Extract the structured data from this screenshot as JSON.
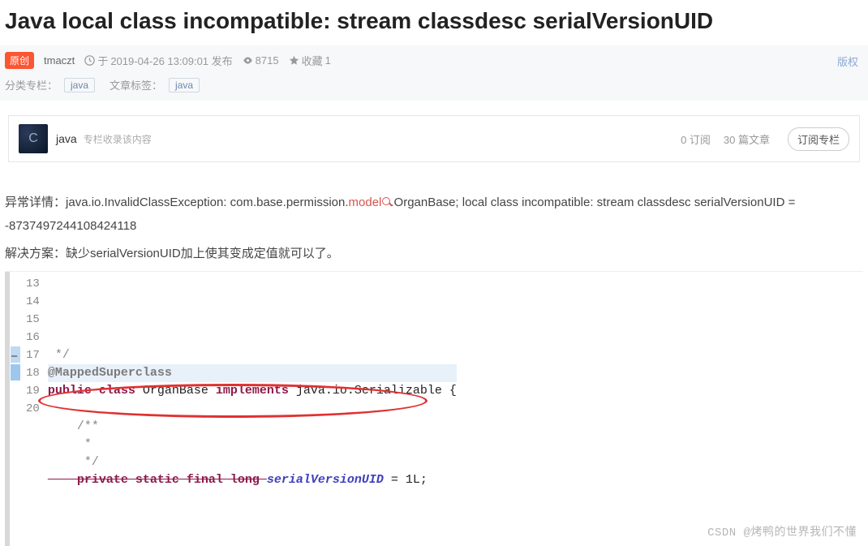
{
  "title": "Java local class incompatible: stream classdesc serialVersionUID",
  "meta": {
    "original_badge": "原创",
    "author": "tmaczt",
    "time_prefix": "于 ",
    "time": "2019-04-26 13:09:01 发布",
    "views": "8715",
    "fav_label": "收藏",
    "fav_count": "1",
    "copyright": "版权",
    "category_label": "分类专栏：",
    "category_tag": "java",
    "tag_label": "文章标签：",
    "tag_value": "java"
  },
  "column": {
    "thumb_letter": "C",
    "name": "java",
    "desc": "专栏收录该内容",
    "subs": "0 订阅",
    "arts": "30 篇文章",
    "button": "订阅专栏"
  },
  "content": {
    "p1_label": "异常详情：",
    "p1_a": "java.io.InvalidClassException: com.base.permission.",
    "p1_red": "model",
    "p1_b": ".OrganBase; local class incompatible: stream classdesc serialVersionUID = -8737497244108424118",
    "p2_label": "解决方案：",
    "p2_text": "缺少serialVersionUID加上使其变成定值就可以了。"
  },
  "code": {
    "lines": [
      "13",
      "14",
      "15",
      "16",
      "17",
      "18",
      "19",
      "20"
    ],
    "l13": " */",
    "l14_ann": "@MappedSuperclass",
    "l15_a": "public class ",
    "l15_b": "OrganBase ",
    "l15_c": "implements ",
    "l15_d": "java.io.Serializable {",
    "l16": "",
    "l17": "    /**",
    "l18": "     *",
    "l19": "     */",
    "l20_a": "    private static final long ",
    "l20_b": "serialVersionUID",
    "l20_c": " = 1L;"
  },
  "watermark": "CSDN @烤鸭的世界我们不懂"
}
